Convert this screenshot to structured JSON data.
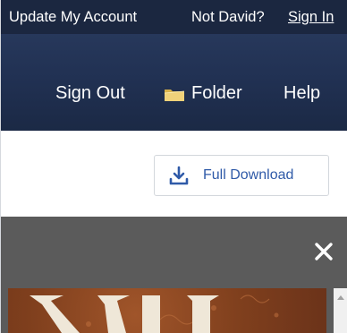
{
  "account_bar": {
    "update_account": "Update My Account",
    "not_user": "Not David?",
    "sign_in": "Sign In"
  },
  "main_nav": {
    "sign_out": "Sign Out",
    "folder": "Folder",
    "help": "Help"
  },
  "toolbar": {
    "full_download": "Full Download"
  },
  "icons": {
    "folder": "folder-icon",
    "download": "download-icon",
    "close": "close-icon"
  },
  "colors": {
    "account_bar": "#1b2740",
    "nav": "#213153",
    "link_blue": "#2f5aa8",
    "viewer_gray": "#5b5b5b"
  }
}
